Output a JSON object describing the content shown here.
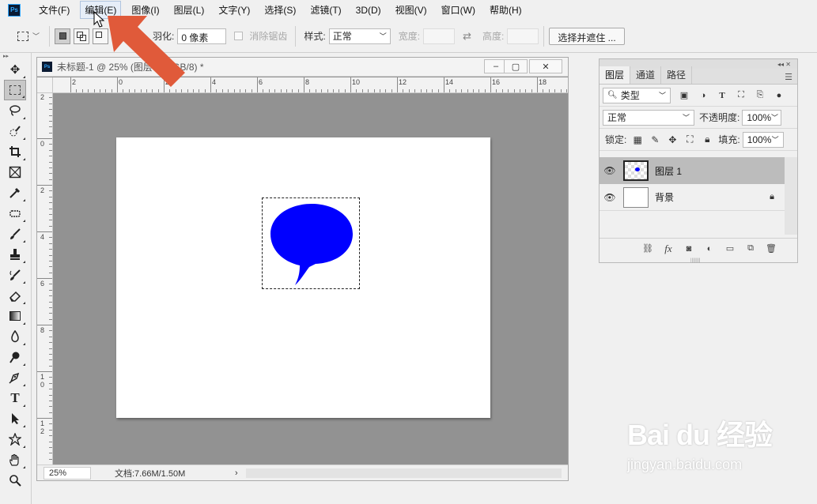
{
  "menubar": {
    "logo": "Ps",
    "items": [
      "文件(F)",
      "编辑(E)",
      "图像(I)",
      "图层(L)",
      "文字(Y)",
      "选择(S)",
      "滤镜(T)",
      "3D(D)",
      "视图(V)",
      "窗口(W)",
      "帮助(H)"
    ],
    "active_index": 1
  },
  "options": {
    "feather_label": "羽化:",
    "feather_value": "0 像素",
    "antialias_label": "消除锯齿",
    "style_label": "样式:",
    "style_value": "正常",
    "width_label": "宽度:",
    "height_label": "高度:",
    "select_mask_button": "选择并遮住 ..."
  },
  "document": {
    "title": "未标题-1 @ 25% (图层 1, RGB/8) *",
    "minimize": "–",
    "maximize": "▢",
    "close": "✕",
    "ruler_top": [
      "2",
      "0",
      "2",
      "4",
      "6",
      "8",
      "10",
      "12",
      "14",
      "16",
      "18"
    ],
    "ruler_left": [
      "2",
      "0",
      "2",
      "4",
      "6",
      "8",
      "1\n0",
      "1\n2"
    ],
    "zoom": "25%",
    "doc_info": "文档:7.66M/1.50M",
    "status_arrow": "›",
    "bubble_color": "#0000ff"
  },
  "layers_panel": {
    "collapse": "◂◂ ✕",
    "tabs": [
      "图层",
      "通道",
      "路径"
    ],
    "active_tab": 0,
    "filter_label": "类型",
    "blend_mode": "正常",
    "opacity_label": "不透明度:",
    "opacity_value": "100%",
    "lock_label": "锁定:",
    "fill_label": "填充:",
    "fill_value": "100%",
    "layers": [
      {
        "name": "图层 1",
        "selected": true,
        "locked": false
      },
      {
        "name": "背景",
        "selected": false,
        "locked": true
      }
    ],
    "footer_fx": "fx"
  },
  "toolbar": {
    "grip": "▸▸"
  },
  "watermark": {
    "logo": "Bai du 经验",
    "url": "jingyan.baidu.com"
  },
  "colors": {
    "annotation_arrow": "#e05a3a",
    "workspace_gray": "#929292"
  }
}
